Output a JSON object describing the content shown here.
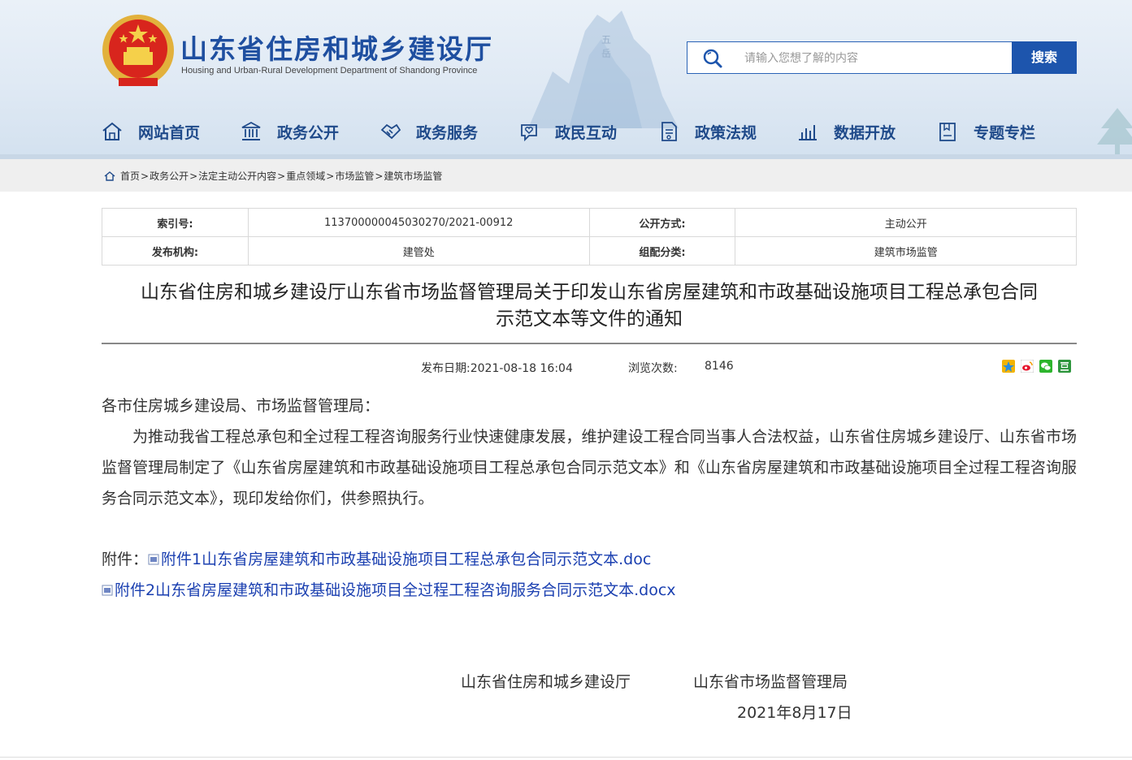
{
  "header": {
    "title": "山东省住房和城乡建设厅",
    "subtitle": "Housing and Urban-Rural Development Department of Shandong Province",
    "search": {
      "placeholder": "请输入您想了解的内容",
      "button_label": "搜索"
    },
    "nav": [
      {
        "label": "网站首页",
        "icon": "home-icon"
      },
      {
        "label": "政务公开",
        "icon": "government-building-icon"
      },
      {
        "label": "政务服务",
        "icon": "handshake-icon"
      },
      {
        "label": "政民互动",
        "icon": "heart-chat-icon"
      },
      {
        "label": "政策法规",
        "icon": "policy-document-icon"
      },
      {
        "label": "数据开放",
        "icon": "bar-chart-icon"
      },
      {
        "label": "专题专栏",
        "icon": "topic-bookmark-icon"
      }
    ],
    "accent_color": "#1d55ad"
  },
  "breadcrumb": [
    "首页",
    "政务公开",
    "法定主动公开内容",
    "重点领域",
    "市场监管",
    "建筑市场监管"
  ],
  "breadcrumb_separator": ">",
  "meta": {
    "index_label": "索引号:",
    "index_value": "11370000004503027 0/2021-00912",
    "open_mode_label": "公开方式:",
    "open_mode_value": "主动公开",
    "publisher_label": "发布机构:",
    "publisher_value": "建管处",
    "category_label": "组配分类:",
    "category_value": "建筑市场监管"
  },
  "article": {
    "title_line1": "山东省住房和城乡建设厅山东省市场监督管理局关于印发山东省房屋建筑和市政基础设施项目工程总承包合同",
    "title_line2": "示范文本等文件的通知",
    "publish_date": "发布日期:2021-08-18 16:04",
    "views_label": "浏览次数:",
    "views_value": "8146",
    "greeting": "各市住房城乡建设局、市场监督管理局：",
    "paragraph": "为推动我省工程总承包和全过程工程咨询服务行业快速健康发展，维护建设工程合同当事人合法权益，山东省住房城乡建设厅、山东省市场监督管理局制定了《山东省房屋建筑和市政基础设施项目工程总承包合同示范文本》和《山东省房屋建筑和市政基础设施项目全过程工程咨询服务合同示范文本》，现印发给你们，供参照执行。",
    "attachment_label": "附件：",
    "attachments": [
      "附件1山东省房屋建筑和市政基础设施项目工程总承包合同示范文本.doc",
      "附件2山东省房屋建筑和市政基础设施项目全过程工程咨询服务合同示范文本.docx"
    ],
    "signer1": "山东省住房和城乡建设厅",
    "signer2": "山东省市场监督管理局",
    "sign_date": "2021年8月17日"
  },
  "share_icons": [
    "qzone-icon",
    "weibo-icon",
    "wechat-icon",
    "douban-icon"
  ]
}
